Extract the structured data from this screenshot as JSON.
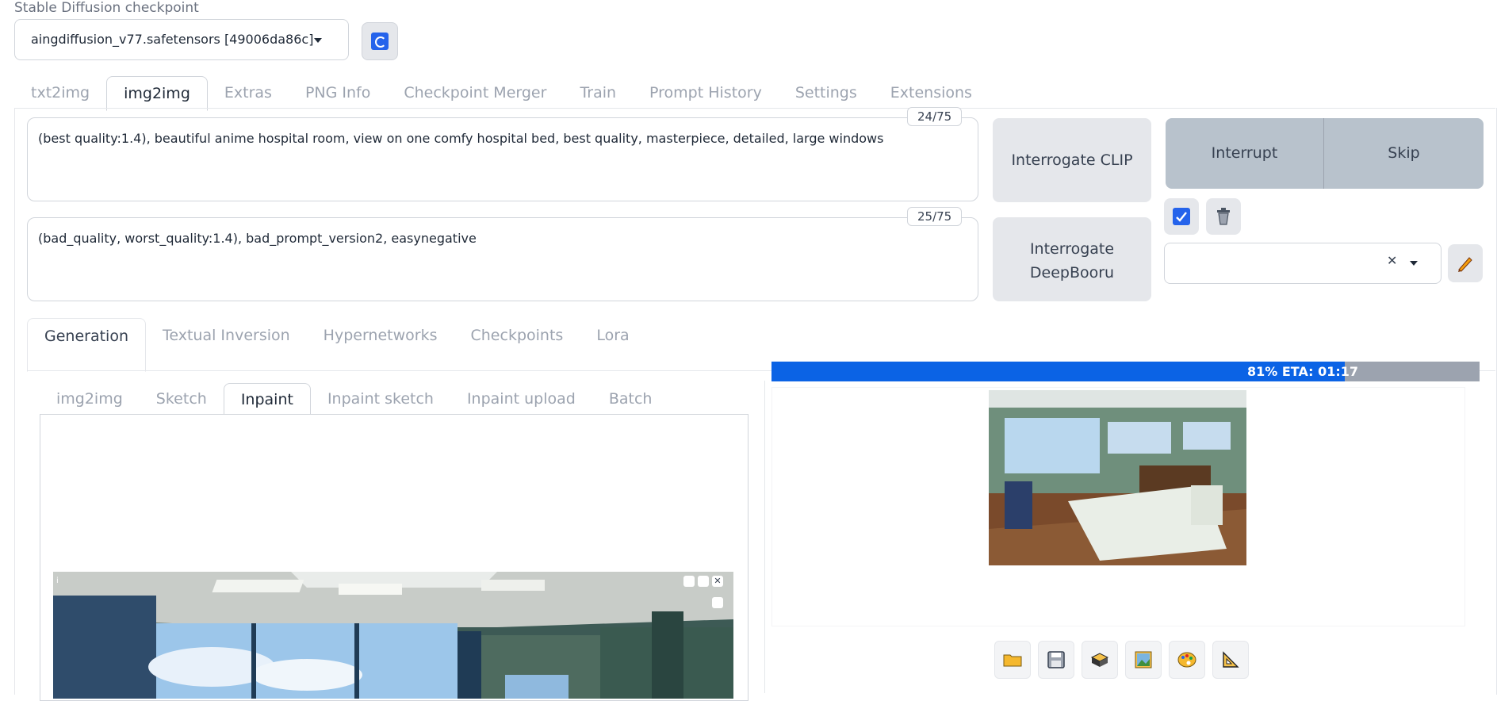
{
  "checkpoint": {
    "label": "Stable Diffusion checkpoint",
    "value": "aingdiffusion_v77.safetensors [49006da86c]"
  },
  "main_tabs": [
    {
      "label": "txt2img"
    },
    {
      "label": "img2img"
    },
    {
      "label": "Extras"
    },
    {
      "label": "PNG Info"
    },
    {
      "label": "Checkpoint Merger"
    },
    {
      "label": "Train"
    },
    {
      "label": "Prompt History"
    },
    {
      "label": "Settings"
    },
    {
      "label": "Extensions"
    }
  ],
  "prompt": {
    "text": "(best quality:1.4), beautiful anime hospital room, view on one  comfy hospital bed, best quality, masterpiece, detailed, large windows",
    "tokens": "24/75"
  },
  "negative": {
    "text": "(bad_quality, worst_quality:1.4), bad_prompt_version2, easynegative",
    "tokens": "25/75"
  },
  "buttons": {
    "interrogate_clip": "Interrogate CLIP",
    "interrogate_deepbooru_line1": "Interrogate",
    "interrogate_deepbooru_line2": "DeepBooru",
    "interrupt": "Interrupt",
    "skip": "Skip"
  },
  "style_dropdown": {
    "value": ""
  },
  "gen_tabs": [
    {
      "label": "Generation"
    },
    {
      "label": "Textual Inversion"
    },
    {
      "label": "Hypernetworks"
    },
    {
      "label": "Checkpoints"
    },
    {
      "label": "Lora"
    }
  ],
  "mode_tabs": [
    {
      "label": "img2img"
    },
    {
      "label": "Sketch"
    },
    {
      "label": "Inpaint"
    },
    {
      "label": "Inpaint sketch"
    },
    {
      "label": "Inpaint upload"
    },
    {
      "label": "Batch"
    }
  ],
  "progress": {
    "percent": 81,
    "text": "81% ETA: 01:17"
  },
  "icons": {
    "folder": "folder-icon",
    "save": "save-icon",
    "zip": "zip-icon",
    "image": "image-icon",
    "palette": "palette-icon",
    "ruler": "ruler-icon"
  },
  "colors": {
    "accent": "#0b63e5",
    "progress_bg": "#9ca3af",
    "interrupt_bg": "#b8c2cc"
  }
}
